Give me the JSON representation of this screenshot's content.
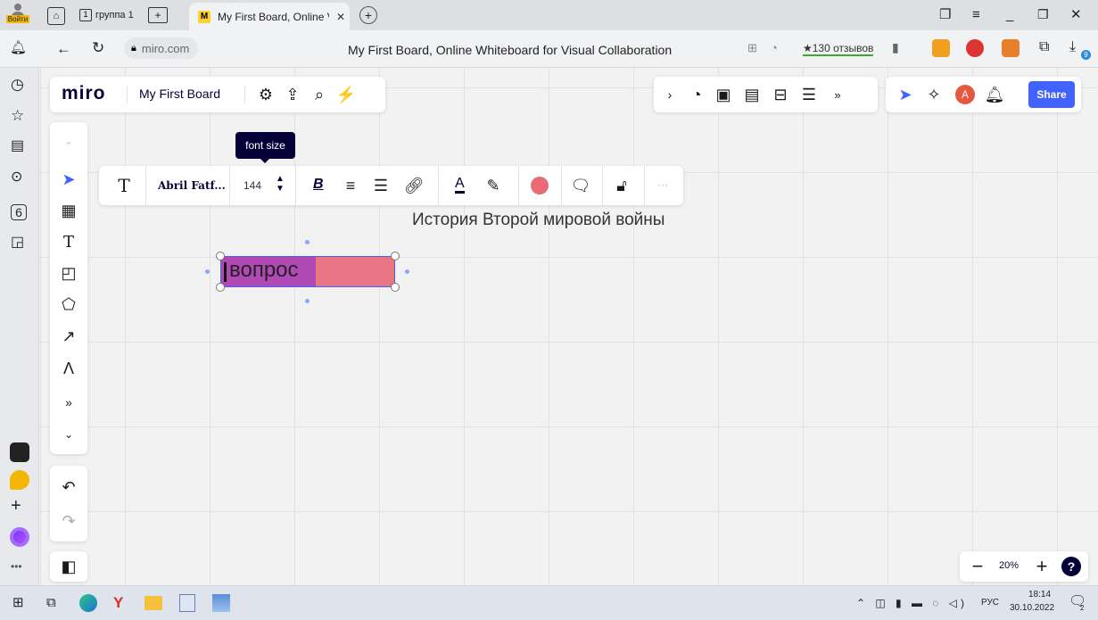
{
  "browser": {
    "login_label": "Войти",
    "tab1_label": "группа 1",
    "active_tab_title": "My First Board, Online V",
    "url": "miro.com",
    "page_title": "My First Board, Online Whiteboard for Visual Collaboration",
    "reviews_label": "★130 отзывов",
    "downloads_badge": "9"
  },
  "miro": {
    "logo": "miro",
    "board_name": "My First Board",
    "share_label": "Share",
    "avatar_initial": "A",
    "zoom_level": "20%",
    "help_label": "?"
  },
  "text_toolbar": {
    "tooltip": "font size",
    "font_name": "Abril Fatf...",
    "font_size": "144",
    "bold_label": "B",
    "text_color_label": "A",
    "more_label": "···"
  },
  "board": {
    "heading": "История Второй мировой войны",
    "sticky_text": "вопрос",
    "accent_color": "#ea7584",
    "selection_color": "#b149b5"
  },
  "taskbar": {
    "lang": "РУС",
    "time": "18:14",
    "date": "30.10.2022",
    "notif_count": "2"
  },
  "colors": {
    "share_bg": "#4262ff",
    "fill_circle": "#ea6a7a"
  }
}
